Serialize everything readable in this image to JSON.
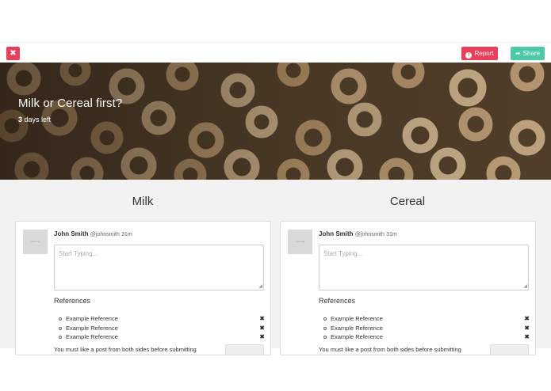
{
  "toolbar": {
    "close_glyph": "✖",
    "report_label": "Report",
    "report_glyph": "!",
    "share_label": "Share",
    "share_glyph": "➦",
    "colors": {
      "danger": "#e83f5b",
      "share": "#4ccaa8"
    }
  },
  "hero": {
    "title": "Milk or Cereal first?",
    "days_count": "3",
    "days_suffix": " days left"
  },
  "sides": [
    {
      "heading": "Milk",
      "post": {
        "avatar_text": "user img",
        "author": "John Smith",
        "handle": "@johnsmith",
        "time": "31m",
        "placeholder": "Start Typing...",
        "references_title": "References",
        "references": [
          "Example Reference",
          "Example Reference",
          "Example Reference"
        ],
        "remove_glyph": "✖",
        "note": "You must like a post from both sides before submitting"
      }
    },
    {
      "heading": "Cereal",
      "post": {
        "avatar_text": "user img",
        "author": "John Smith",
        "handle": "@johnsmith",
        "time": "31m",
        "placeholder": "Start Typing...",
        "references_title": "References",
        "references": [
          "Example Reference",
          "Example Reference",
          "Example Reference"
        ],
        "remove_glyph": "✖",
        "note": "You must like a post from both sides before submitting"
      }
    }
  ]
}
